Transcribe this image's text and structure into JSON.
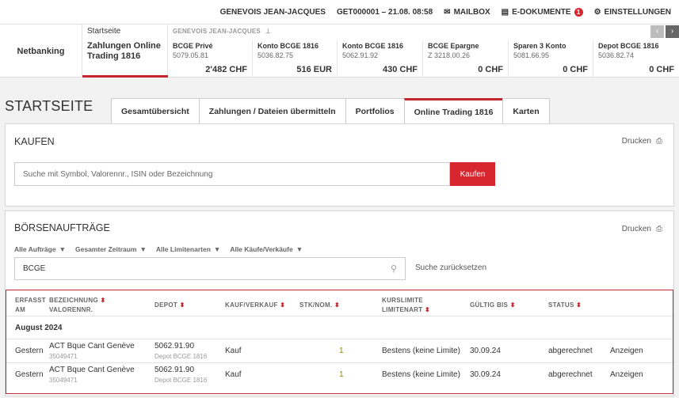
{
  "topbar": {
    "user": "GENEVOIS JEAN-JACQUES",
    "session": "GET000001 – 21.08. 08:58",
    "mailbox": "MAILBOX",
    "edokumente": "E-DOKUMENTE",
    "edok_count": "1",
    "settings": "EINSTELLUNGEN"
  },
  "nav": {
    "netbanking": "Netbanking",
    "start_label": "Startseite",
    "current": "Zahlungen Online Trading 1816",
    "owner": "GENEVOIS JEAN-JACQUES",
    "prev": "‹",
    "next": "›"
  },
  "accounts": [
    {
      "name": "BCGE Privé",
      "number": "5079.05.81",
      "balance": "2'482 CHF"
    },
    {
      "name": "Konto BCGE 1816",
      "number": "5036.82.75",
      "balance": "516 EUR"
    },
    {
      "name": "Konto BCGE 1816",
      "number": "5062.91.92",
      "balance": "430 CHF"
    },
    {
      "name": "BCGE Epargne",
      "number": "Z 3218.00.26",
      "balance": "0 CHF"
    },
    {
      "name": "Sparen 3 Konto",
      "number": "5081.66.95",
      "balance": "0 CHF"
    },
    {
      "name": "Depot BCGE 1816",
      "number": "5036.82.74",
      "balance": "0 CHF"
    }
  ],
  "page": {
    "title": "STARTSEITE"
  },
  "tabs": [
    "Gesamtübersicht",
    "Zahlungen / Dateien übermitteln",
    "Portfolios",
    "Online Trading 1816",
    "Karten"
  ],
  "buy": {
    "title": "KAUFEN",
    "print": "Drucken",
    "placeholder": "Suche mit Symbol, Valorennr., ISIN oder Bezeichnung",
    "button": "Kaufen"
  },
  "orders": {
    "title": "BÖRSENAUFTRÄGE",
    "print": "Drucken",
    "filters": [
      "Alle Aufträge",
      "Gesamter Zeitraum",
      "Alle Limitenarten",
      "Alle Käufe/Verkäufe"
    ],
    "search_value": "BCGE",
    "reset": "Suche zurücksetzen",
    "headers": {
      "erfasst": "ERFASST",
      "am": "AM",
      "bez": "BEZEICHNUNG",
      "valor": "VALORENNR.",
      "depot": "DEPOT",
      "kauf": "KAUF/VERKAUF",
      "stk": "STK/NOM.",
      "kurs": "KURSLIMITE",
      "limitart": "LIMITENART",
      "gueltig": "GÜLTIG BIS",
      "status": "STATUS"
    },
    "group": "August 2024",
    "rows": [
      {
        "date": "Gestern",
        "name": "ACT Bque Cant Genève",
        "valor": "35049471",
        "depot": "5062.91.90",
        "depot_name": "Depot BCGE 1816",
        "side": "Kauf",
        "qty": "1",
        "limit": "Bestens (keine Limite)",
        "valid": "30.09.24",
        "status": "abgerechnet",
        "action": "Anzeigen"
      },
      {
        "date": "Gestern",
        "name": "ACT Bque Cant Genève",
        "valor": "35049471",
        "depot": "5062.91.90",
        "depot_name": "Depot BCGE 1816",
        "side": "Kauf",
        "qty": "1",
        "limit": "Bestens (keine Limite)",
        "valid": "30.09.24",
        "status": "abgerechnet",
        "action": "Anzeigen"
      }
    ]
  }
}
